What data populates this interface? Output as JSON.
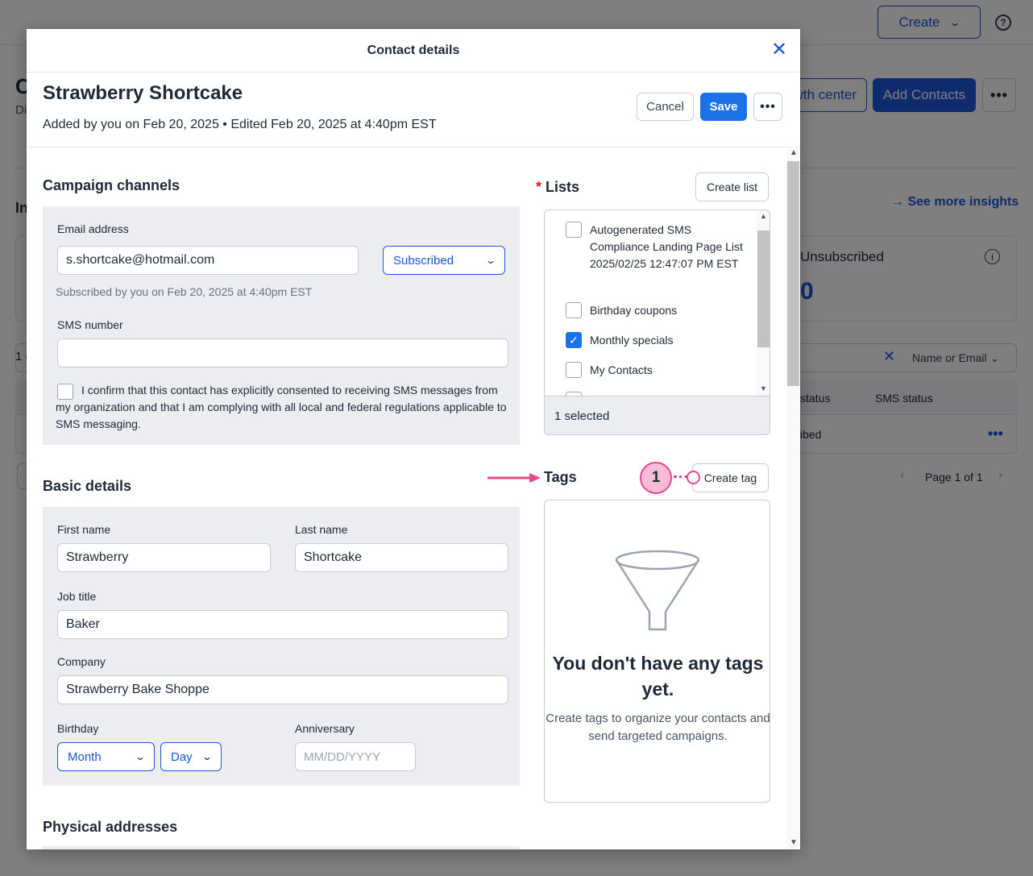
{
  "background": {
    "create_label": "Create",
    "help_icon": "?",
    "title_partial": "C",
    "subtitle_partial": "Di",
    "growth_label": "wth center",
    "add_contacts_label": "Add Contacts",
    "insights_heading_partial": "In",
    "see_more_label": "See more insights",
    "unsubscribed_label": "Unsubscribed",
    "unsubscribed_value": "0",
    "count_partial": "1 (",
    "search_scope": "Name or Email",
    "col_email_status": "status",
    "col_sms_status": "SMS status",
    "row_status_partial": "ibed",
    "pager_label": "Page 1 of 1"
  },
  "modal": {
    "title": "Contact details",
    "close_icon": "✕",
    "contact_name": "Strawberry Shortcake",
    "meta": "Added by you on Feb 20, 2025 • Edited Feb 20, 2025 at 4:40pm EST",
    "cancel_label": "Cancel",
    "save_label": "Save",
    "more_icon": "•••"
  },
  "campaign": {
    "heading": "Campaign channels",
    "email_label": "Email address",
    "email_value": "s.shortcake@hotmail.com",
    "subscription_status": "Subscribed",
    "subscribed_note": "Subscribed by you on Feb 20, 2025 at 4:40pm EST",
    "sms_label": "SMS number",
    "sms_value": "",
    "consent_text": "I confirm that this contact has explicitly consented to receiving SMS messages from my organization and that I am complying with all local and federal regulations applicable to SMS messaging."
  },
  "lists": {
    "required_mark": "*",
    "heading": "Lists",
    "create_label": "Create list",
    "items": [
      {
        "label": "Autogenerated SMS Compliance Landing Page List 2025/02/25 12:47:07 PM EST",
        "checked": false
      },
      {
        "label": "Birthday coupons",
        "checked": false
      },
      {
        "label": "Monthly specials",
        "checked": true
      },
      {
        "label": "My Contacts",
        "checked": false
      }
    ],
    "selected_count": "1 selected"
  },
  "tags": {
    "heading": "Tags",
    "create_label": "Create tag",
    "empty_title": "You don't have any tags yet.",
    "empty_desc": "Create tags to organize your contacts and send targeted campaigns.",
    "empty_icon": "funnel-icon"
  },
  "annotation": {
    "badge_number": "1",
    "color": "#e8468f"
  },
  "basic": {
    "heading": "Basic details",
    "first_name_label": "First name",
    "first_name_value": "Strawberry",
    "last_name_label": "Last name",
    "last_name_value": "Shortcake",
    "job_title_label": "Job title",
    "job_title_value": "Baker",
    "company_label": "Company",
    "company_value": "Strawberry Bake Shoppe",
    "birthday_label": "Birthday",
    "month_placeholder": "Month",
    "day_placeholder": "Day",
    "anniversary_label": "Anniversary",
    "anniversary_placeholder": "MM/DD/YYYY"
  },
  "addresses": {
    "heading": "Physical addresses"
  },
  "colors": {
    "primary": "#1a73e8",
    "link": "#1a56db",
    "panel": "#ebedf0",
    "required": "#d11a2a"
  }
}
